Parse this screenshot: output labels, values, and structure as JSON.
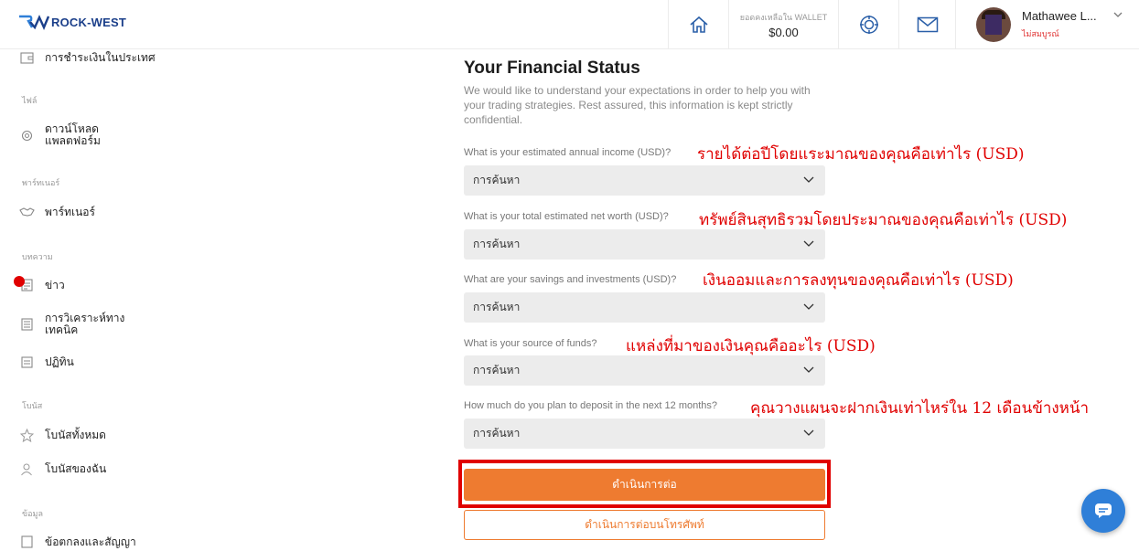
{
  "header": {
    "logo_text": "ROCK-WEST",
    "wallet_label": "ยอดคงเหลือใน WALLET",
    "wallet_value": "$0.00",
    "user_name": "Mathawee L...",
    "user_status": "ไม่สมบูรณ์",
    "icons": [
      "home-icon",
      "target-icon",
      "mail-icon",
      "chevron-down-icon"
    ]
  },
  "sidebar": {
    "top_item": "การชำระเงินในประเทศ",
    "section_files": "ไฟล์",
    "download_line1": "ดาวน์โหลด",
    "download_line2": "แพลตฟอร์ม",
    "section_partner": "พาร์ทเนอร์",
    "partner": "พาร์ทเนอร์",
    "section_articles": "บทความ",
    "news": "ข่าว",
    "analysis_line1": "การวิเคราะห์ทาง",
    "analysis_line2": "เทคนิค",
    "calendar": "ปฏิทิน",
    "section_bonus": "โบนัส",
    "all_bonus": "โบนัสทั้งหมด",
    "my_bonus": "โบนัสของฉัน",
    "section_data": "ข้อมูล",
    "data_item": "ข้อตกลงและสัญญา"
  },
  "main": {
    "title": "Your Financial Status",
    "description": "We would like to understand your expectations in order to help you with your trading strategies. Rest assured, this information is kept strictly confidential.",
    "questions": [
      {
        "label": "What is your estimated annual income (USD)?",
        "annotation": "รายได้ต่อปีโดยแระมาณของคุณคือเท่าไร (USD)",
        "placeholder": "การค้นหา"
      },
      {
        "label": "What is your total estimated net worth (USD)?",
        "annotation": "ทรัพย์สินสุทธิรวมโดยประมาณของคุณคือเท่าไร (USD)",
        "placeholder": "การค้นหา"
      },
      {
        "label": "What are your savings and investments (USD)?",
        "annotation": "เงินออมและการลงทุนของคุณคือเท่าไร (USD)",
        "placeholder": "การค้นหา"
      },
      {
        "label": "What is your source of funds?",
        "annotation": "แหล่งที่มาของเงินคุณคืออะไร (USD)",
        "placeholder": "การค้นหา"
      },
      {
        "label": "How much do you plan to deposit in the next 12 months?",
        "annotation": "คุณวางแผนจะฝากเงินเท่าไหร่ใน 12 เดือนข้างหน้า",
        "placeholder": "การค้นหา"
      }
    ],
    "continue_label": "ดำเนินการต่อ",
    "continue_phone_label": "ดำเนินการต่อบนโทรศัพท์"
  },
  "colors": {
    "accent": "#ee7b30",
    "annotation": "#e00000",
    "logo": "#1b3f8a",
    "chat": "#2f7fd8"
  }
}
